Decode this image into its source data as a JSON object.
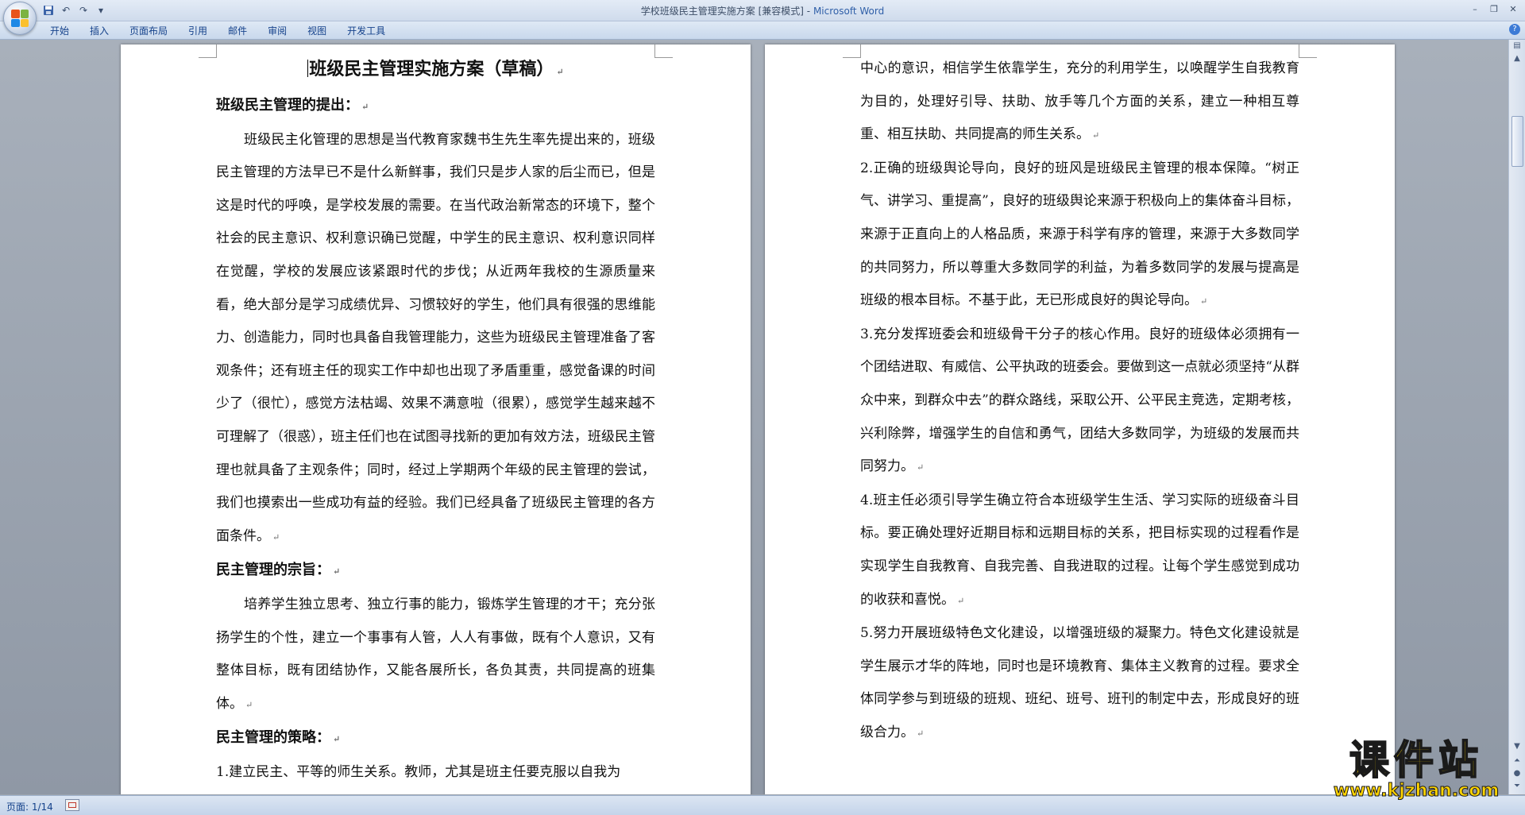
{
  "window": {
    "doc_name": "学校班级民主管理实施方案 [兼容模式]",
    "separator": " - ",
    "app_name": "Microsoft Word"
  },
  "quick_access": [
    "save-icon",
    "undo-icon",
    "redo-icon",
    "customize-icon"
  ],
  "ribbon": {
    "tabs": [
      "开始",
      "插入",
      "页面布局",
      "引用",
      "邮件",
      "审阅",
      "视图",
      "开发工具"
    ]
  },
  "page1": {
    "title": "班级民主管理实施方案（草稿）",
    "h1": "班级民主管理的提出：",
    "p1": "班级民主化管理的思想是当代教育家魏书生先生率先提出来的，班级民主管理的方法早已不是什么新鲜事，我们只是步人家的后尘而已，但是这是时代的呼唤，是学校发展的需要。在当代政治新常态的环境下，整个社会的民主意识、权利意识确已觉醒，中学生的民主意识、权利意识同样在觉醒，学校的发展应该紧跟时代的步伐；从近两年我校的生源质量来看，绝大部分是学习成绩优异、习惯较好的学生，他们具有很强的思维能力、创造能力，同时也具备自我管理能力，这些为班级民主管理准备了客观条件；还有班主任的现实工作中却也出现了矛盾重重，感觉备课的时间少了（很忙），感觉方法枯竭、效果不满意啦（很累），感觉学生越来越不可理解了（很惑），班主任们也在试图寻找新的更加有效方法，班级民主管理也就具备了主观条件；同时，经过上学期两个年级的民主管理的尝试，我们也摸索出一些成功有益的经验。我们已经具备了班级民主管理的各方面条件。",
    "h2": "民主管理的宗旨：",
    "p2": "培养学生独立思考、独立行事的能力，锻炼学生管理的才干；充分张扬学生的个性，建立一个事事有人管，人人有事做，既有个人意识，又有整体目标，既有团结协作，又能各展所长，各负其责，共同提高的班集体。",
    "h3": "民主管理的策略：",
    "p3": "1.建立民主、平等的师生关系。教师，尤其是班主任要克服以自我为"
  },
  "page2": {
    "p1": "中心的意识，相信学生依靠学生，充分的利用学生，以唤醒学生自我教育为目的，处理好引导、扶助、放手等几个方面的关系，建立一种相互尊重、相互扶助、共同提高的师生关系。",
    "p2": "2.正确的班级舆论导向，良好的班风是班级民主管理的根本保障。“树正气、讲学习、重提高”，良好的班级舆论来源于积极向上的集体奋斗目标，来源于正直向上的人格品质，来源于科学有序的管理，来源于大多数同学的共同努力，所以尊重大多数同学的利益，为着多数同学的发展与提高是班级的根本目标。不基于此，无已形成良好的舆论导向。",
    "p3": "3.充分发挥班委会和班级骨干分子的核心作用。良好的班级体必须拥有一个团结进取、有威信、公平执政的班委会。要做到这一点就必须坚持“从群众中来，到群众中去”的群众路线，采取公开、公平民主竞选，定期考核，兴利除弊，增强学生的自信和勇气，团结大多数同学，为班级的发展而共同努力。",
    "p4": "4.班主任必须引导学生确立符合本班级学生生活、学习实际的班级奋斗目标。要正确处理好近期目标和远期目标的关系，把目标实现的过程看作是实现学生自我教育、自我完善、自我进取的过程。让每个学生感觉到成功的收获和喜悦。",
    "p5": "5.努力开展班级特色文化建设，以增强班级的凝聚力。特色文化建设就是学生展示才华的阵地，同时也是环境教育、集体主义教育的过程。要求全体同学参与到班级的班规、班纪、班号、班刊的制定中去，形成良好的班级合力。"
  },
  "paragraph_mark": "↵",
  "statusbar": {
    "page": "页面: 1/14"
  },
  "watermark": {
    "text": "课件站",
    "url": "www.kjzhan.com"
  },
  "colors": {
    "ribbon_text": "#15428b",
    "workspace": "#9ca3ad",
    "watermark": "#f7d200"
  }
}
